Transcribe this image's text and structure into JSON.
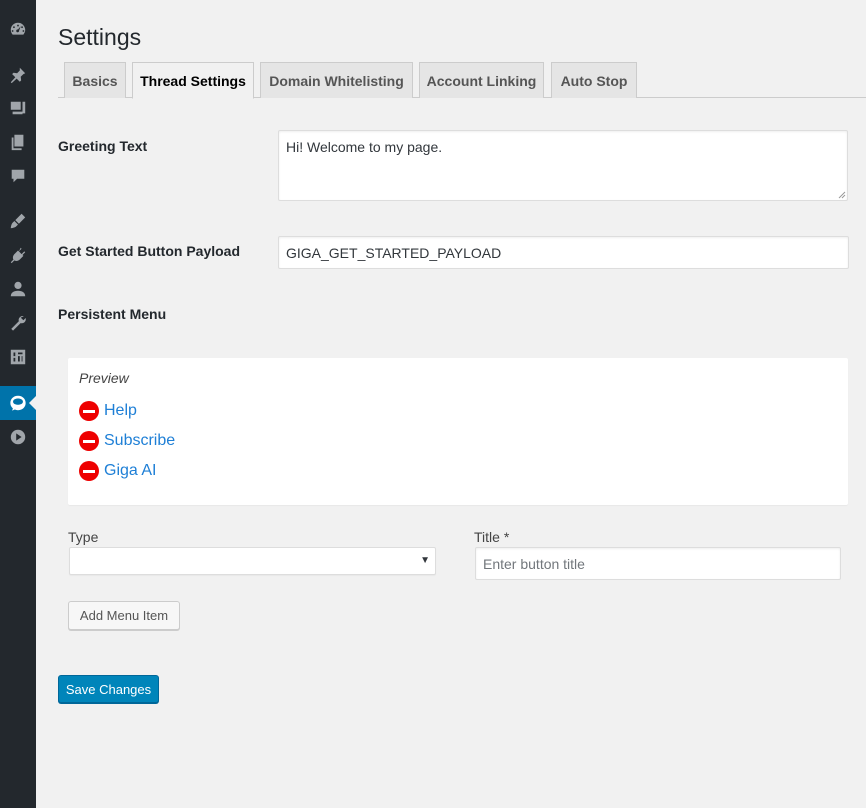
{
  "sidebar": {
    "icons": [
      "dashboard-icon",
      "pin-icon",
      "media-icon",
      "pages-icon",
      "comments-icon",
      "appearance-icon",
      "plugins-icon",
      "users-icon",
      "tools-icon",
      "settings-icon",
      "chatbot-icon",
      "play-icon"
    ],
    "current": "chatbot-icon"
  },
  "page": {
    "title": "Settings"
  },
  "tabs": [
    {
      "label": "Basics",
      "active": false
    },
    {
      "label": "Thread Settings",
      "active": true
    },
    {
      "label": "Domain Whitelisting",
      "active": false
    },
    {
      "label": "Account Linking",
      "active": false
    },
    {
      "label": "Auto Stop",
      "active": false
    }
  ],
  "greeting": {
    "label": "Greeting Text",
    "value": "Hi! Welcome to my page."
  },
  "get_started": {
    "label": "Get Started Button Payload",
    "value": "GIGA_GET_STARTED_PAYLOAD"
  },
  "persistent_menu": {
    "label": "Persistent Menu",
    "preview_title": "Preview",
    "items": [
      "Help",
      "Subscribe",
      "Giga AI"
    ]
  },
  "form": {
    "type_label": "Type",
    "type_value": "",
    "title_label": "Title *",
    "title_placeholder": "Enter button title",
    "add_button": "Add Menu Item"
  },
  "save_button": "Save Changes",
  "colors": {
    "accent": "#0085ba",
    "sidebar": "#23282d",
    "remove": "#ee0000",
    "link": "#1e7fd6"
  }
}
